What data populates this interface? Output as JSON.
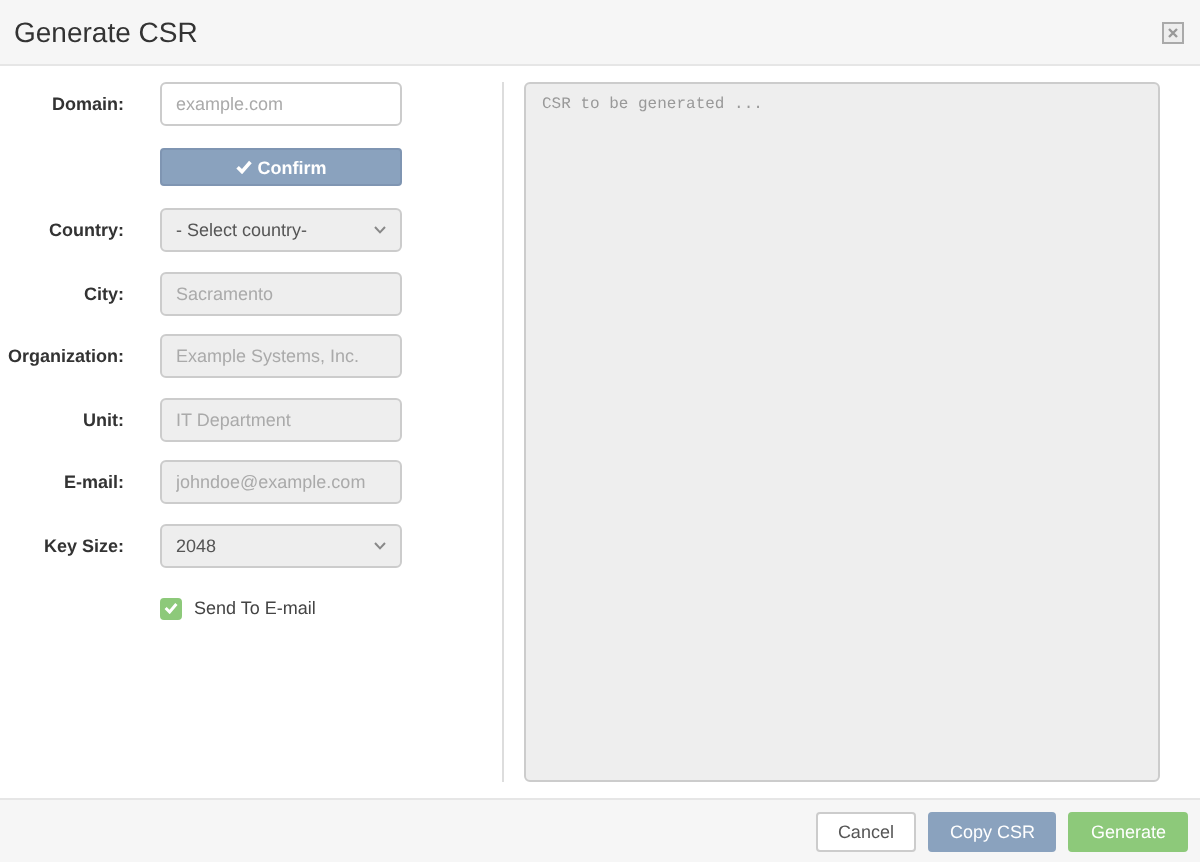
{
  "window": {
    "title": "Generate CSR"
  },
  "form": {
    "fields": [
      {
        "kind": "input",
        "label": "Domain:",
        "placeholder": "example.com",
        "disabled": false
      },
      {
        "kind": "button",
        "label": "Confirm",
        "disabled": false
      },
      {
        "kind": "select",
        "label": "Country:",
        "value": "- Select country-",
        "disabled": true
      },
      {
        "kind": "input",
        "label": "City:",
        "placeholder": "Sacramento",
        "disabled": true
      },
      {
        "kind": "input",
        "label": "Organization:",
        "placeholder": "Example Systems, Inc.",
        "disabled": true
      },
      {
        "kind": "input",
        "label": "Unit:",
        "placeholder": "IT Department",
        "disabled": true
      },
      {
        "kind": "input",
        "label": "E-mail:",
        "placeholder": "johndoe@example.com",
        "disabled": true
      },
      {
        "kind": "select",
        "label": "Key Size:",
        "value": "2048",
        "disabled": true
      },
      {
        "kind": "checkbox",
        "label": "Send To E-mail",
        "checked": true
      }
    ]
  },
  "output": {
    "placeholder": "CSR to be generated ..."
  },
  "buttons": [
    {
      "kind": "default",
      "label": "Cancel"
    },
    {
      "kind": "secondary",
      "label": "Copy CSR"
    },
    {
      "kind": "success",
      "label": "Generate"
    }
  ]
}
